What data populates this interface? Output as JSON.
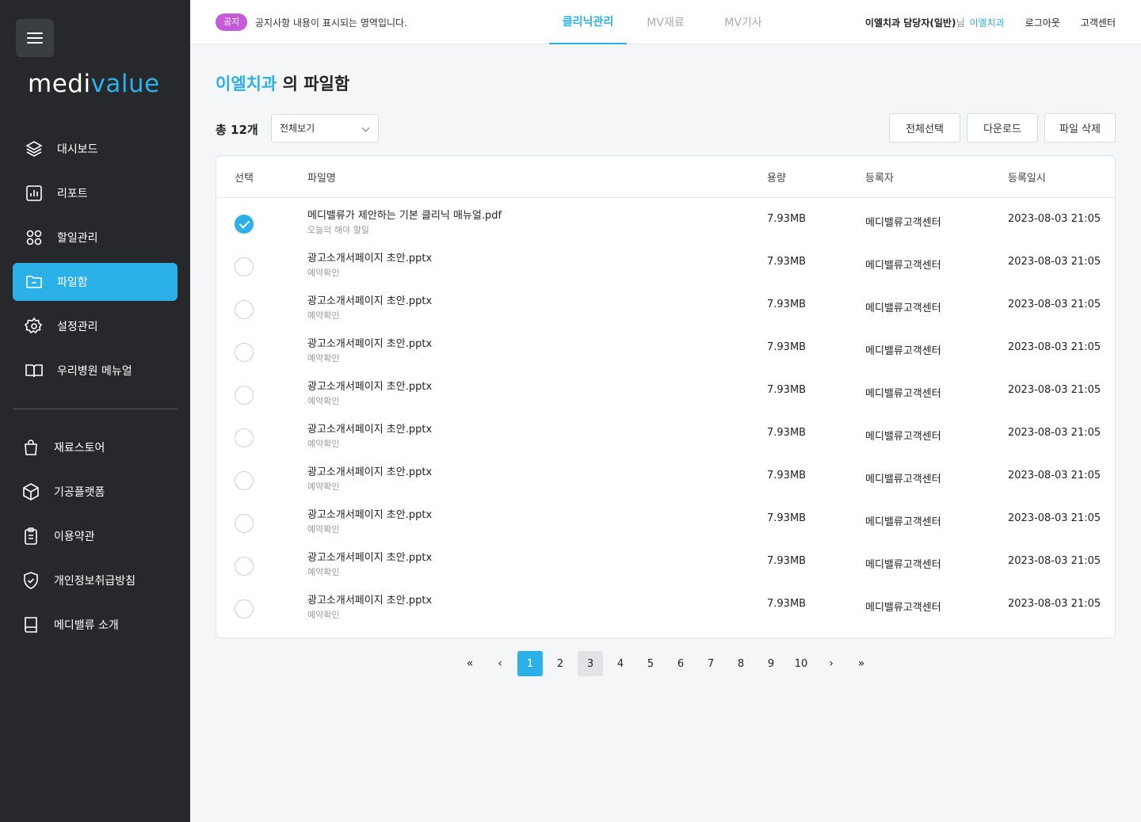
{
  "sidebar": {
    "logo_main": "medi",
    "logo_accent": "value",
    "nav": [
      {
        "label": "대시보드",
        "icon": "layers-icon"
      },
      {
        "label": "리포트",
        "icon": "chart-icon"
      },
      {
        "label": "할일관리",
        "icon": "grid-icon"
      },
      {
        "label": "파일함",
        "icon": "folder-icon"
      },
      {
        "label": "설정관리",
        "icon": "gear-icon"
      },
      {
        "label": "우리병원 메뉴얼",
        "icon": "book-open-icon"
      }
    ],
    "nav2": [
      {
        "label": "재료스토어",
        "icon": "bag-icon"
      },
      {
        "label": "기공플랫폼",
        "icon": "box-icon"
      },
      {
        "label": "이용약관",
        "icon": "clipboard-icon"
      },
      {
        "label": "개인정보취급방침",
        "icon": "shield-icon"
      },
      {
        "label": "메디밸류 소개",
        "icon": "book-icon"
      }
    ],
    "accent_color": "#2bb0e8",
    "bg_color": "#26282c"
  },
  "topbar": {
    "notice_badge": "공지",
    "notice_text": "공지사항 내용이 표시되는 영역입니다.",
    "tabs": [
      "클리닉관리",
      "MV재료",
      "MV기사"
    ],
    "active_tab": "클리닉관리",
    "user_name": "이엘치과 담당자(일반)",
    "user_suffix": "님",
    "user_clinic": "이엘치과",
    "logout": "로그아웃",
    "support": "고객센터"
  },
  "main": {
    "title_clinic": "이엘치과",
    "title_rest": " 의 파일함",
    "total": "총 12개",
    "filter_value": "전체보기",
    "buttons": {
      "select_all": "전체선택",
      "download": "다운로드",
      "delete": "파일 삭제"
    },
    "columns": [
      "선택",
      "파일명",
      "용량",
      "등록자",
      "등록일시"
    ],
    "rows": [
      {
        "checked": true,
        "name": "메디밸류가 제안하는 기본 클리닉 매뉴얼.pdf",
        "sub": "오늘의 해야 할일",
        "size": "7.93MB",
        "writer": "메디밸류고객센터",
        "date": "2023-08-03 21:05"
      },
      {
        "checked": false,
        "name": "광고소개서페이지 초안.pptx",
        "sub": "예약확인",
        "size": "7.93MB",
        "writer": "메디밸류고객센터",
        "date": "2023-08-03 21:05"
      },
      {
        "checked": false,
        "name": "광고소개서페이지 초안.pptx",
        "sub": "예약확인",
        "size": "7.93MB",
        "writer": "메디밸류고객센터",
        "date": "2023-08-03 21:05"
      },
      {
        "checked": false,
        "name": "광고소개서페이지 초안.pptx",
        "sub": "예약확인",
        "size": "7.93MB",
        "writer": "메디밸류고객센터",
        "date": "2023-08-03 21:05"
      },
      {
        "checked": false,
        "name": "광고소개서페이지 초안.pptx",
        "sub": "예약확인",
        "size": "7.93MB",
        "writer": "메디밸류고객센터",
        "date": "2023-08-03 21:05"
      },
      {
        "checked": false,
        "name": "광고소개서페이지 초안.pptx",
        "sub": "예약확인",
        "size": "7.93MB",
        "writer": "메디밸류고객센터",
        "date": "2023-08-03 21:05"
      },
      {
        "checked": false,
        "name": "광고소개서페이지 초안.pptx",
        "sub": "예약확인",
        "size": "7.93MB",
        "writer": "메디밸류고객센터",
        "date": "2023-08-03 21:05"
      },
      {
        "checked": false,
        "name": "광고소개서페이지 초안.pptx",
        "sub": "예약확인",
        "size": "7.93MB",
        "writer": "메디밸류고객센터",
        "date": "2023-08-03 21:05"
      },
      {
        "checked": false,
        "name": "광고소개서페이지 초안.pptx",
        "sub": "예약확인",
        "size": "7.93MB",
        "writer": "메디밸류고객센터",
        "date": "2023-08-03 21:05"
      },
      {
        "checked": false,
        "name": "광고소개서페이지 초안.pptx",
        "sub": "예약확인",
        "size": "7.93MB",
        "writer": "메디밸류고객센터",
        "date": "2023-08-03 21:05"
      }
    ]
  },
  "pagination": {
    "first": "«",
    "prev": "‹",
    "pages": [
      "1",
      "2",
      "3",
      "4",
      "5",
      "6",
      "7",
      "8",
      "9",
      "10"
    ],
    "current": "1",
    "hovered": "3",
    "next": "›",
    "last": "»"
  }
}
